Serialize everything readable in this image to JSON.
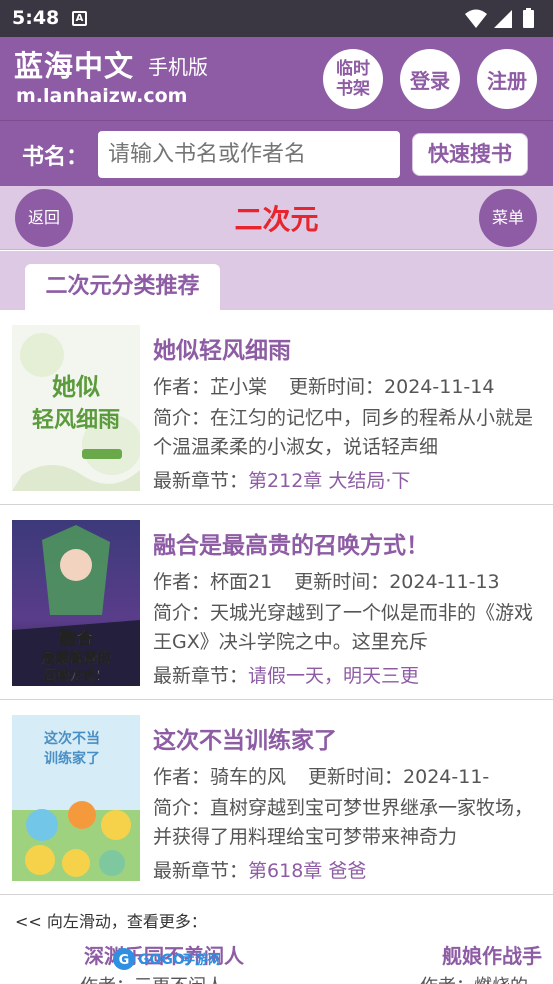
{
  "status_bar": {
    "time": "5:48",
    "notification_glyph": "A"
  },
  "header": {
    "site_name": "蓝海中文",
    "site_sub": "手机版",
    "site_url": "m.lanhaizw.com",
    "shelf_line1": "临时",
    "shelf_line2": "书架",
    "login": "登录",
    "register": "注册"
  },
  "search": {
    "label": "书名：",
    "placeholder": "请输入书名或作者名",
    "button": "快速搜书"
  },
  "nav": {
    "back": "返回",
    "title": "二次元",
    "menu": "菜单"
  },
  "section": {
    "tab": "二次元分类推荐"
  },
  "books": [
    {
      "title": "她似轻风细雨",
      "author_label": "作者：",
      "author": "芷小棠",
      "updated_label": "更新时间：",
      "updated": "2024-11-14",
      "intro_label": "简介：",
      "intro": "在江匀的记忆中，同乡的程希从小就是个温温柔柔的小淑女，说话轻声细",
      "latest_label": "最新章节：",
      "latest": "第212章 大结局·下",
      "cover_text": "她似轻风细雨"
    },
    {
      "title": "融合是最高贵的召唤方式！",
      "author_label": "作者：",
      "author": "杯面21",
      "updated_label": "更新时间：",
      "updated": "2024-11-13",
      "intro_label": "简介：",
      "intro": "天城光穿越到了一个似是而非的《游戏王GX》决斗学院之中。这里充斥",
      "latest_label": "最新章节：",
      "latest": "请假一天，明天三更",
      "cover_text": "融合是最高贵的召唤方式！"
    },
    {
      "title": "这次不当训练家了",
      "author_label": "作者：",
      "author": "骑车的风",
      "updated_label": "更新时间：",
      "updated": "2024-11-",
      "intro_label": "简介：",
      "intro": "直树穿越到宝可梦世界继承一家牧场，并获得了用料理给宝可梦带来神奇力",
      "latest_label": "最新章节：",
      "latest": "第618章 爸爸",
      "cover_text": "这次不当训练家了"
    }
  ],
  "more": {
    "hint": "<< 向左滑动，查看更多：",
    "item1_title": "深渊乐园不养闲人",
    "item1_author": "作者：三更不闲人",
    "item2_title": "舰娘作战手",
    "item2_author": "作者：燃烧的",
    "watermark": "GOGO手游网"
  },
  "colors": {
    "brand": "#8e5ca4",
    "nav_bg": "#ddc9e3",
    "title_red": "#e8242c"
  }
}
